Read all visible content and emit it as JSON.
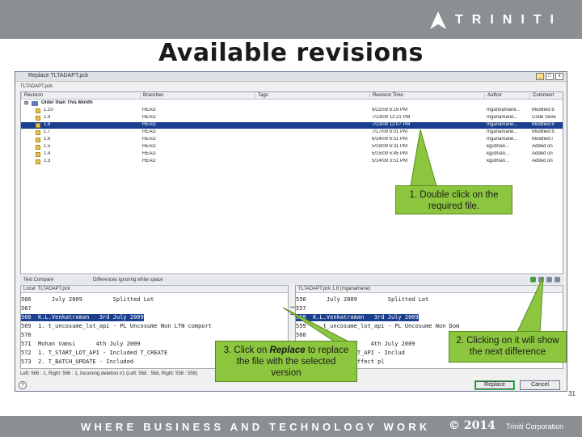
{
  "brand": {
    "logo_text": "TRINITI",
    "accent": "#8cc63f",
    "bar_color": "#8a8f92"
  },
  "slide": {
    "title": "Available revisions",
    "page_number": "31"
  },
  "dialog": {
    "title": "Replace TLTADAPT.pck",
    "crumb": "TLTADAPT.pck",
    "columns": [
      "Revision",
      "Branches",
      "Tags",
      "Revision Time",
      "Author",
      "Comment"
    ],
    "group_label": "Older than This Month",
    "rows": [
      {
        "rev": "1.10",
        "branch": "HEAD",
        "tag": "",
        "time": "9/22/09 6:19 PM",
        "author": "mgannamane...",
        "comment": "Modified b"
      },
      {
        "rev": "1.9",
        "branch": "HEAD",
        "tag": "",
        "time": "7/23/09 12:21 PM",
        "author": "mganamane...",
        "comment": "Code Seve"
      },
      {
        "rev": "1.8",
        "branch": "HEAD",
        "tag": "",
        "time": "7/23/09 12:07 PM",
        "author": "mganamane...",
        "comment": "Modified b"
      },
      {
        "rev": "1.7",
        "branch": "HEAD",
        "tag": "",
        "time": "7/17/09 6:01 PM",
        "author": "mganamane...",
        "comment": "Modified b"
      },
      {
        "rev": "1.6",
        "branch": "HEAD",
        "tag": "",
        "time": "6/24/09 6:51 PM",
        "author": "mganamane...",
        "comment": "Modified r"
      },
      {
        "rev": "1.5",
        "branch": "HEAD",
        "tag": "",
        "time": "5/19/09 6:31 PM",
        "author": "kgutman...",
        "comment": "Added on"
      },
      {
        "rev": "1.4",
        "branch": "HEAD",
        "tag": "",
        "time": "5/15/09 5:45 PM",
        "author": "kgutman...",
        "comment": "Added on"
      },
      {
        "rev": "1.3",
        "branch": "HEAD",
        "tag": "",
        "time": "5/14/09 3:51 PM",
        "author": "kgutman...",
        "comment": "Added on"
      }
    ],
    "selected_index": 2,
    "compare_label": "Text Compare",
    "compare_option": "Differences ignoring white space",
    "left_pane_title": "Local: TLTADAPT.pck",
    "right_pane_title": "TLTADAPT.pck 1.8 (mganamane)",
    "left_lines": [
      "566      July 2009         Splitted Lot",
      "567",
      "568  K.L.Venkatraman   3rd July 2009",
      "569  1. t_uncosume_lot_api - PL Uncosume Non LTN comport",
      "570",
      "571  Mohan Vamsi      4th July 2009",
      "572  1. T_START_LOT_API - Included T_CREATE",
      "573  2. T_BATCH_UPDATE - Included"
    ],
    "right_lines": [
      "556      July 2009         Splitted Lot",
      "557",
      "558  K.L.Venkatraman   3rd July 2009",
      "559  1. t_uncosume_lot_api - PL Uncosume Non Dom",
      "560",
      "561  Mohan Vamsi      4th July 2009",
      "562  1. T_START_LOT_API - Includ",
      "563  2. will not effect pl"
    ],
    "status_text": "Left: 566 : 1, Right: 566 : 1, Incoming deletion #1 (Left: 568 : 568, Right: 558 : 558)",
    "buttons": {
      "replace": "Replace",
      "cancel": "Cancel"
    },
    "help_glyph": "?",
    "window_glyphs": {
      "minimize": "_",
      "maximize": "□",
      "close": "x"
    }
  },
  "callouts": {
    "c1": "1. Double click on the required file.",
    "c2_prefix": "3. Click on ",
    "c2_emph": "Replace",
    "c2_suffix": " to replace the file with the selected version",
    "c3": "2. Clicking on it will show the next difference"
  },
  "footer": {
    "tagline": "WHERE BUSINESS AND TECHNOLOGY WORK",
    "copyright": "© 2014",
    "corp": "Triniti Corporation"
  }
}
